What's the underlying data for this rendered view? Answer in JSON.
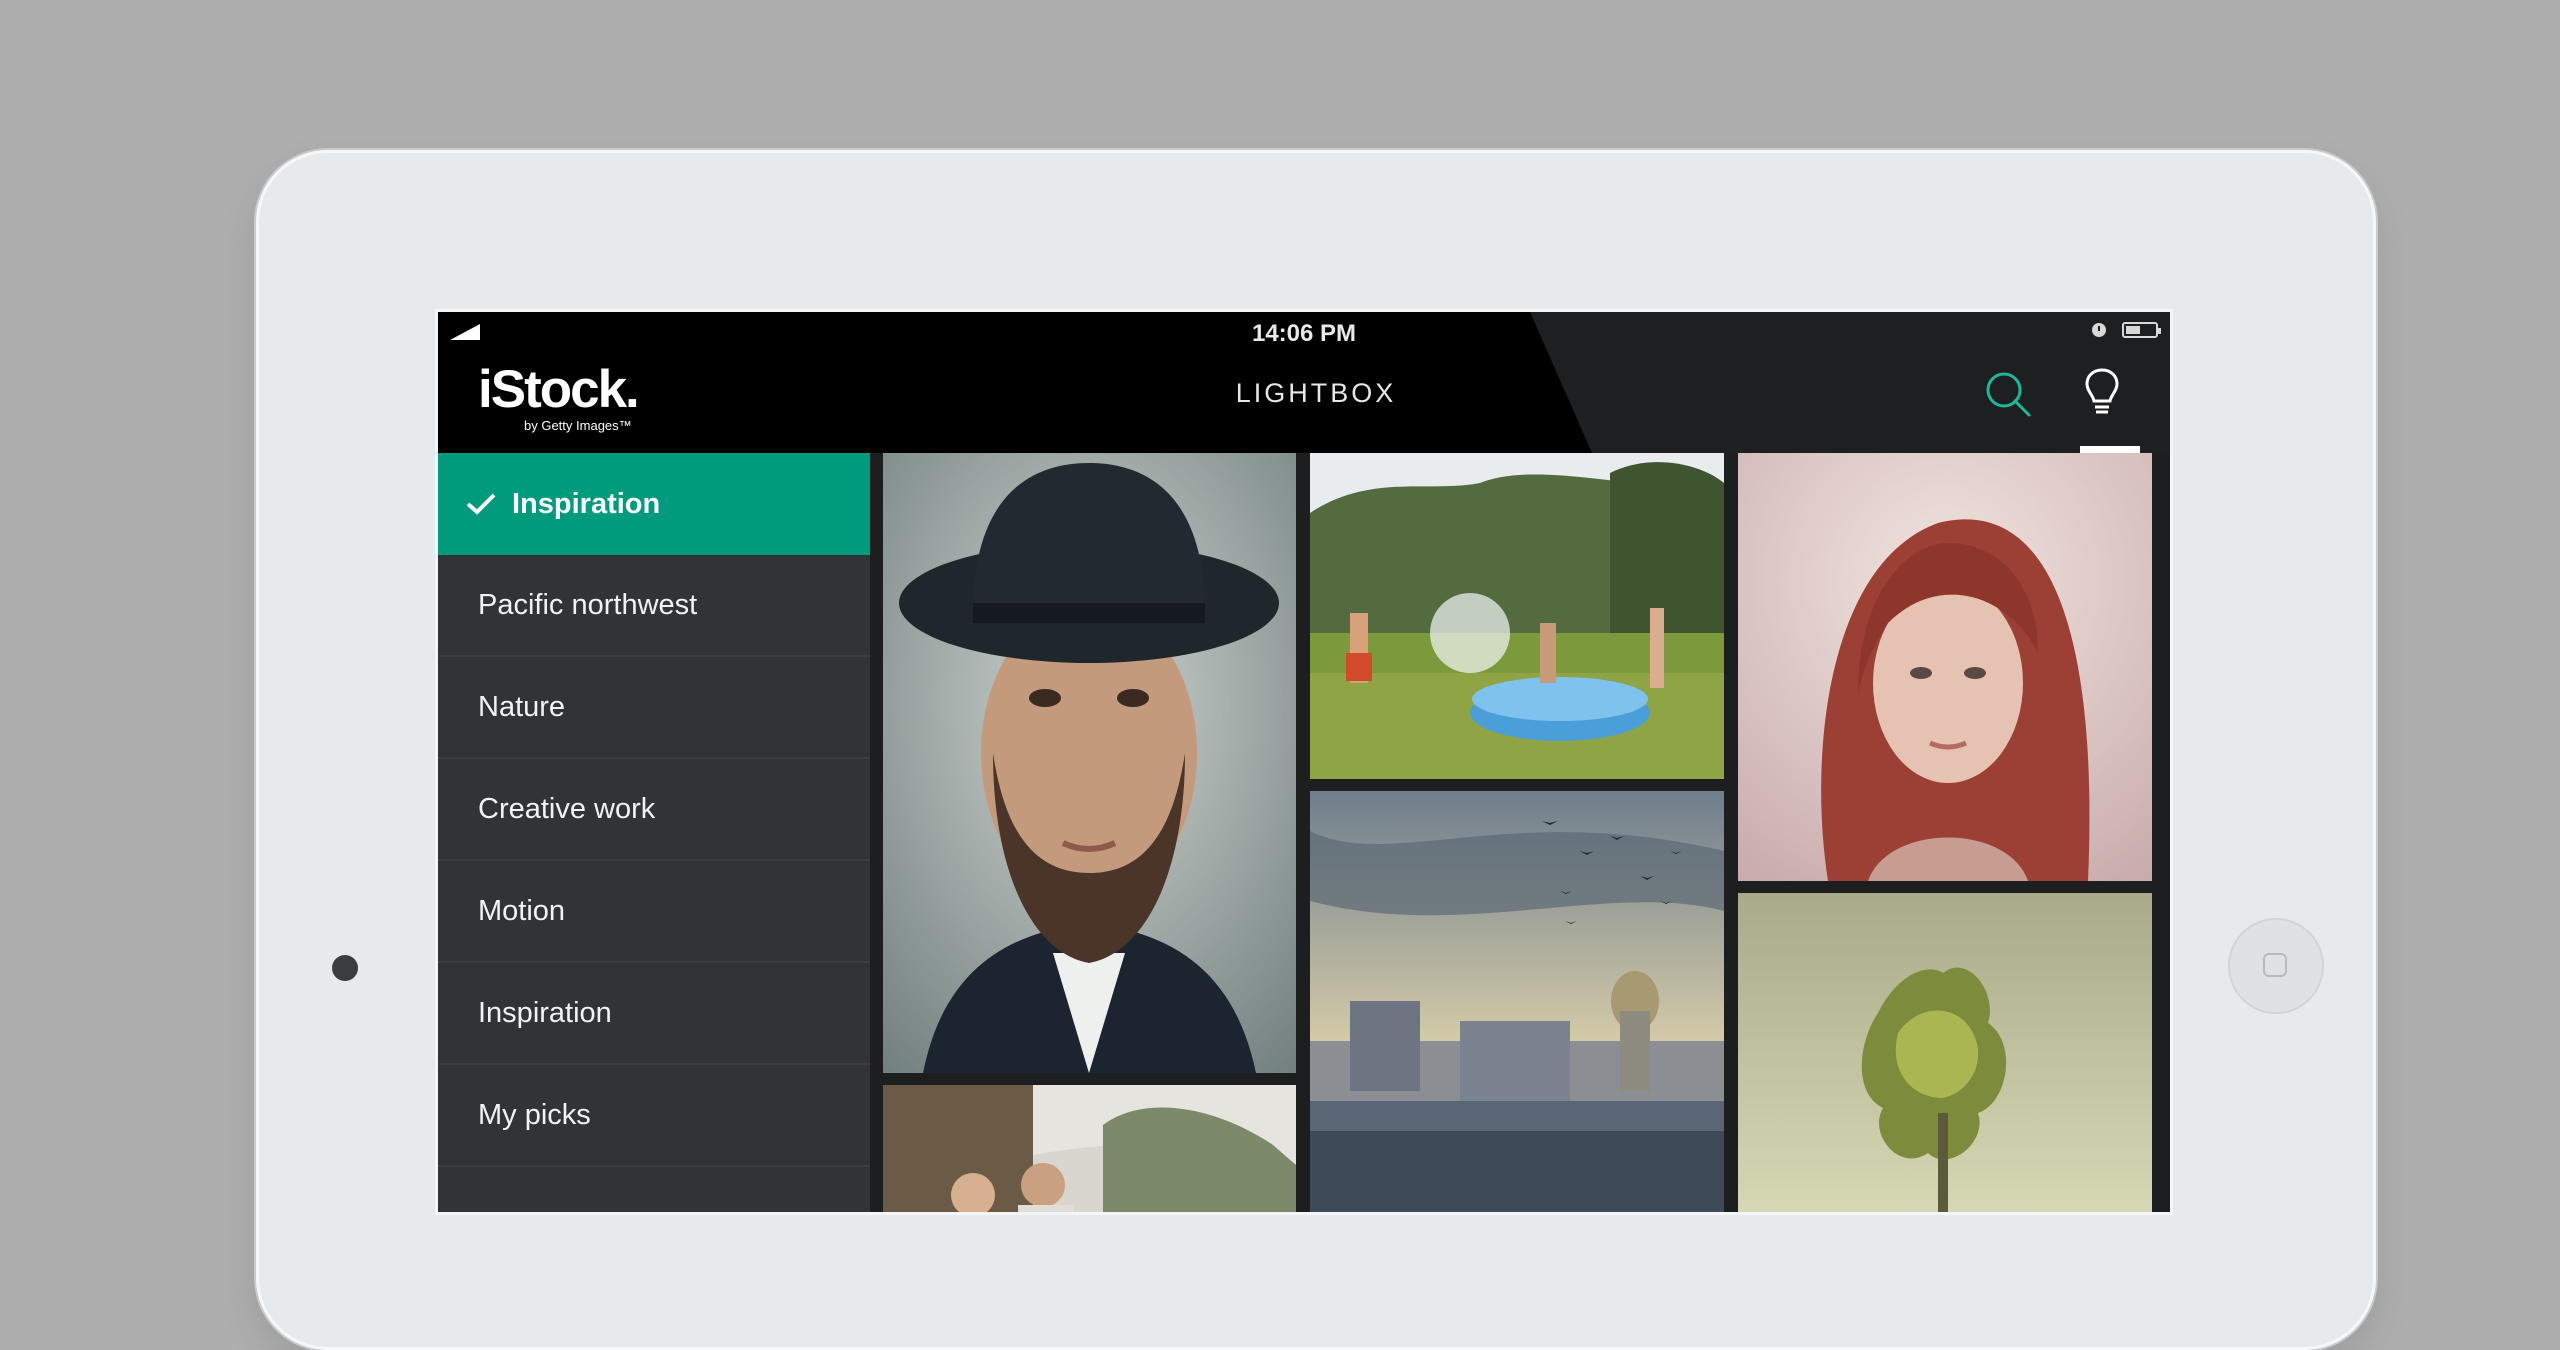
{
  "status_bar": {
    "time": "14:06 PM"
  },
  "header": {
    "logo": "iStock.",
    "logo_sub": "by Getty Images™",
    "title": "LIGHTBOX",
    "icons": [
      "search-icon",
      "lightbulb-icon"
    ],
    "accent_color": "#1ab99a"
  },
  "sidebar": {
    "items": [
      {
        "label": "Inspiration",
        "selected": true
      },
      {
        "label": "Pacific northwest"
      },
      {
        "label": "Nature"
      },
      {
        "label": "Creative work"
      },
      {
        "label": "Motion"
      },
      {
        "label": "Inspiration"
      },
      {
        "label": "My picks"
      },
      {
        "label": ""
      }
    ],
    "selected_color": "#009a7d"
  },
  "gallery": {
    "images": [
      "portrait-man-hat",
      "children-water-pool",
      "portrait-woman-red-hair",
      "couple-forest",
      "paris-skyline-birds",
      "tree-field"
    ]
  }
}
